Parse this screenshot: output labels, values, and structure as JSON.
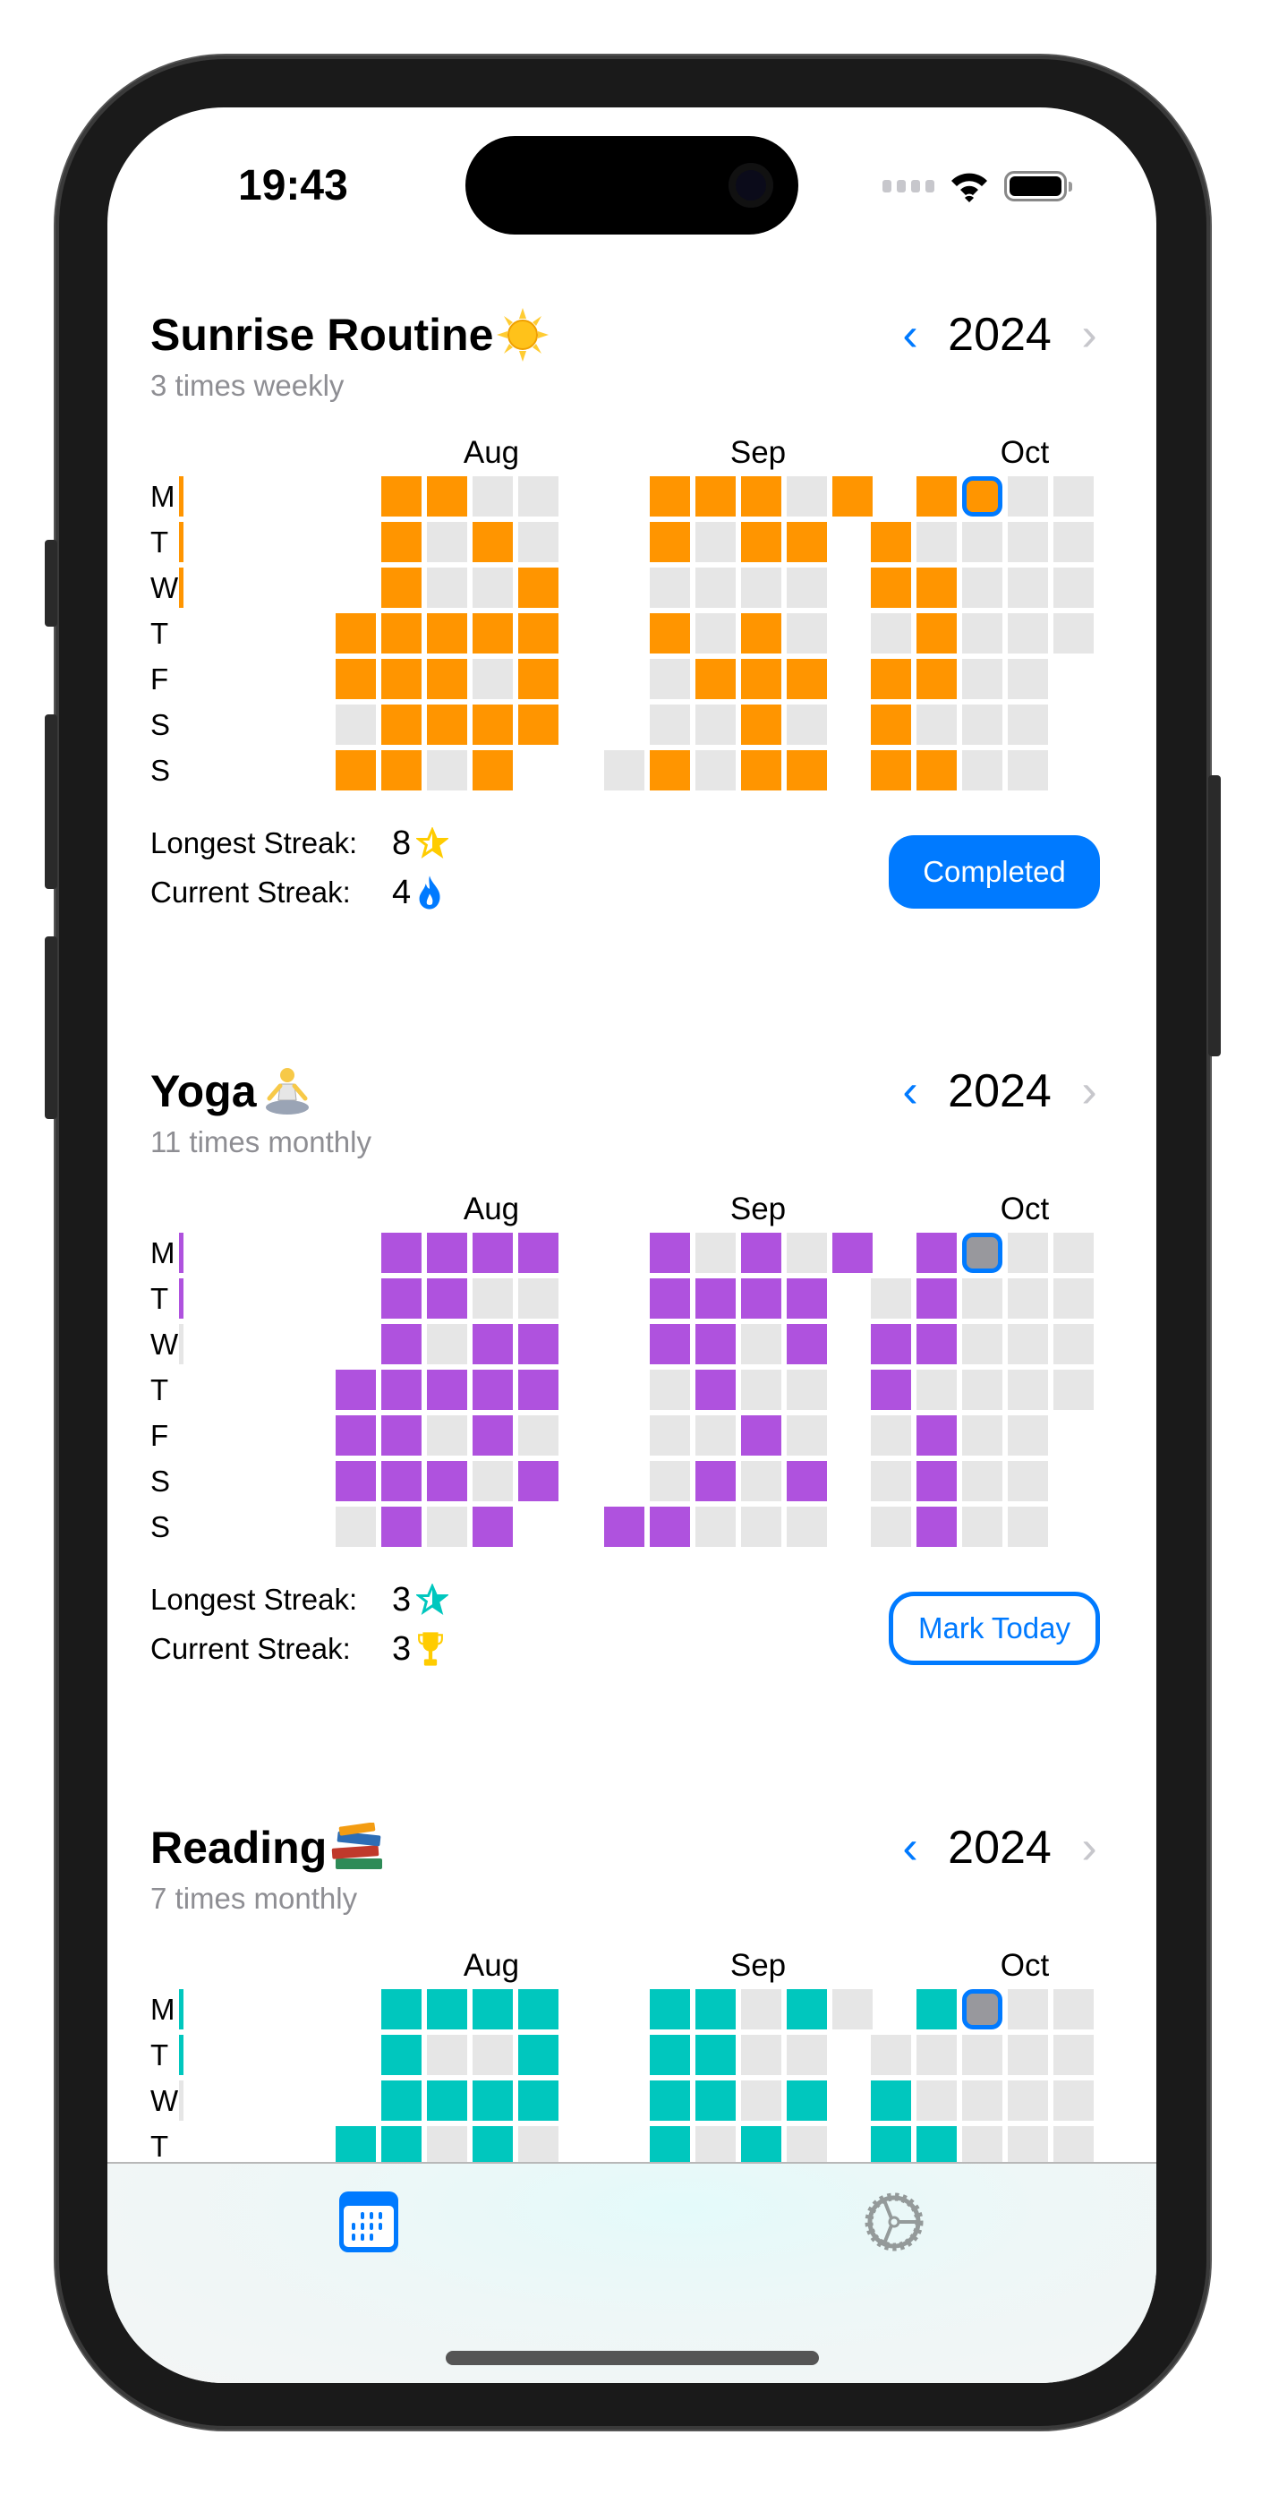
{
  "status_bar": {
    "time": "19:43"
  },
  "months": [
    "Aug",
    "Sep",
    "Oct"
  ],
  "day_labels": [
    "M",
    "T",
    "W",
    "T",
    "F",
    "S",
    "S"
  ],
  "colors": {
    "accent": "#007aff",
    "empty_cell": "#e6e6e6",
    "today_empty": "#98989d"
  },
  "stat_labels": {
    "longest": "Longest Streak:",
    "current": "Current Streak:"
  },
  "habits": [
    {
      "name": "Sunrise Routine",
      "emoji_icon": "sun-icon",
      "frequency": "3 times weekly",
      "year": "2024",
      "color": "#ff9500",
      "week_progress": [
        1,
        1,
        1
      ],
      "grid": {
        "Aug": [
          ".1100",
          ".1010",
          ".1001",
          "11111",
          "11101",
          "01111",
          "1101."
        ],
        "Sep": [
          ".11101",
          ".1011.",
          ".0000.",
          ".1010.",
          ".0111.",
          ".0010.",
          "01011."
        ],
        "Oct": [
          ".1100",
          "10000",
          "11000",
          "01000",
          "1100.",
          "1000.",
          "1100."
        ]
      },
      "today": {
        "month": "Oct",
        "row": 0,
        "col": 2
      },
      "longest_streak": "8",
      "longest_icon": "star-icon",
      "longest_icon_color": "#ffcc00",
      "current_streak": "4",
      "current_icon": "flame-icon",
      "current_icon_color": "#007aff",
      "action_label": "Completed",
      "action_state": "completed"
    },
    {
      "name": "Yoga",
      "emoji_icon": "yoga-person-icon",
      "frequency": "11 times monthly",
      "year": "2024",
      "color": "#af52de",
      "week_progress": [
        1,
        1,
        0
      ],
      "grid": {
        "Aug": [
          ".1111",
          ".1100",
          ".1011",
          "11111",
          "11010",
          "11101",
          "0101."
        ],
        "Sep": [
          ".10101",
          ".1111.",
          ".1101.",
          ".0100.",
          ".0010.",
          ".0101.",
          "11000."
        ],
        "Oct": [
          ".1000",
          "01000",
          "11000",
          "10000",
          "0100.",
          "0100.",
          "0100."
        ]
      },
      "today": {
        "month": "Oct",
        "row": 0,
        "col": 2
      },
      "longest_streak": "3",
      "longest_icon": "star-icon",
      "longest_icon_color": "#00c7be",
      "current_streak": "3",
      "current_icon": "trophy-icon",
      "current_icon_color": "#ffcc00",
      "action_label": "Mark Today",
      "action_state": "pending"
    },
    {
      "name": "Reading",
      "emoji_icon": "books-icon",
      "frequency": "7 times monthly",
      "year": "2024",
      "color": "#00c7be",
      "week_progress": [
        1,
        1,
        0
      ],
      "grid": {
        "Aug": [
          ".1111",
          ".1001",
          ".1111",
          "11010"
        ],
        "Sep": [
          ".11010",
          ".1100.",
          ".1101.",
          ".1010."
        ],
        "Oct": [
          ".1000",
          "00000",
          "10000",
          "11000"
        ]
      },
      "today": {
        "month": "Oct",
        "row": 0,
        "col": 2
      }
    }
  ],
  "tab_bar": {
    "tabs": [
      {
        "name": "calendar",
        "icon": "calendar-icon",
        "selected": true
      },
      {
        "name": "settings",
        "icon": "gear-icon",
        "selected": false
      }
    ]
  }
}
